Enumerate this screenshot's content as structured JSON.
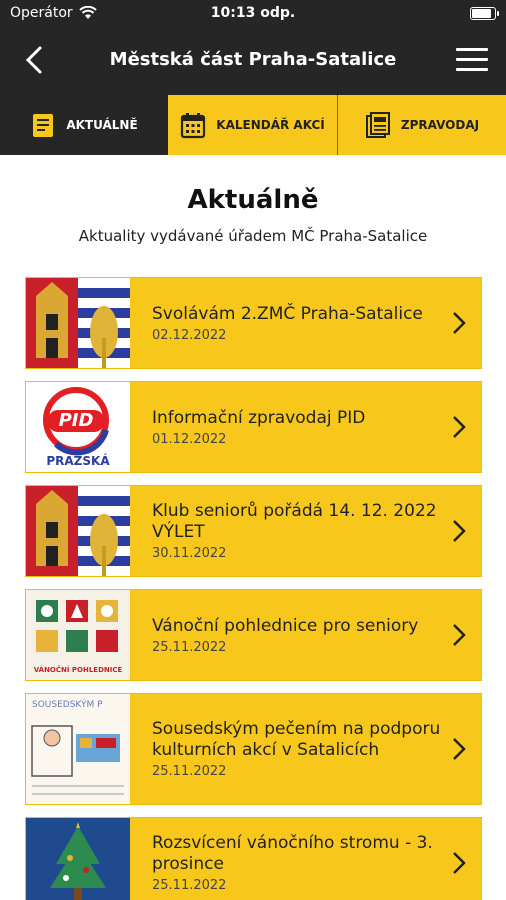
{
  "status": {
    "carrier": "Operátor",
    "time": "10:13 odp."
  },
  "nav": {
    "title": "Městská část Praha-Satalice"
  },
  "tabs": [
    {
      "label": "AKTUÁLNĚ",
      "icon": "news-icon"
    },
    {
      "label": "KALENDÁŘ AKCÍ",
      "icon": "calendar-icon"
    },
    {
      "label": "ZPRAVODAJ",
      "icon": "newsletter-icon"
    }
  ],
  "page": {
    "heading": "Aktuálně",
    "subtitle": "Aktuality vydávané úřadem MČ Praha-Satalice"
  },
  "items": [
    {
      "title": "Svolávám 2.ZMČ Praha-Satalice",
      "date": "02.12.2022",
      "thumb": "coat-of-arms"
    },
    {
      "title": "Informační zpravodaj PID",
      "date": "01.12.2022",
      "thumb": "pid-logo",
      "thumb_text": "PID",
      "thumb_caption": "PRAŽSKÁ"
    },
    {
      "title": "Klub seniorů pořádá 14. 12. 2022 VÝLET",
      "date": "30.11.2022",
      "thumb": "coat-of-arms"
    },
    {
      "title": "Vánoční pohlednice pro seniory",
      "date": "25.11.2022",
      "thumb": "christmas-cards",
      "thumb_caption": "VÁNOČNÍ POHLEDNICE"
    },
    {
      "title": "Sousedským pečením na podporu kulturních akcí v Satalicích",
      "date": "25.11.2022",
      "thumb": "drawing",
      "thumb_text": "SOUSEDSKÝM P"
    },
    {
      "title": "Rozsvícení vánočního stromu - 3. prosince",
      "date": "25.11.2022",
      "thumb": "christmas-tree"
    }
  ],
  "colors": {
    "accent": "#f7c81b",
    "dark": "#262626"
  }
}
